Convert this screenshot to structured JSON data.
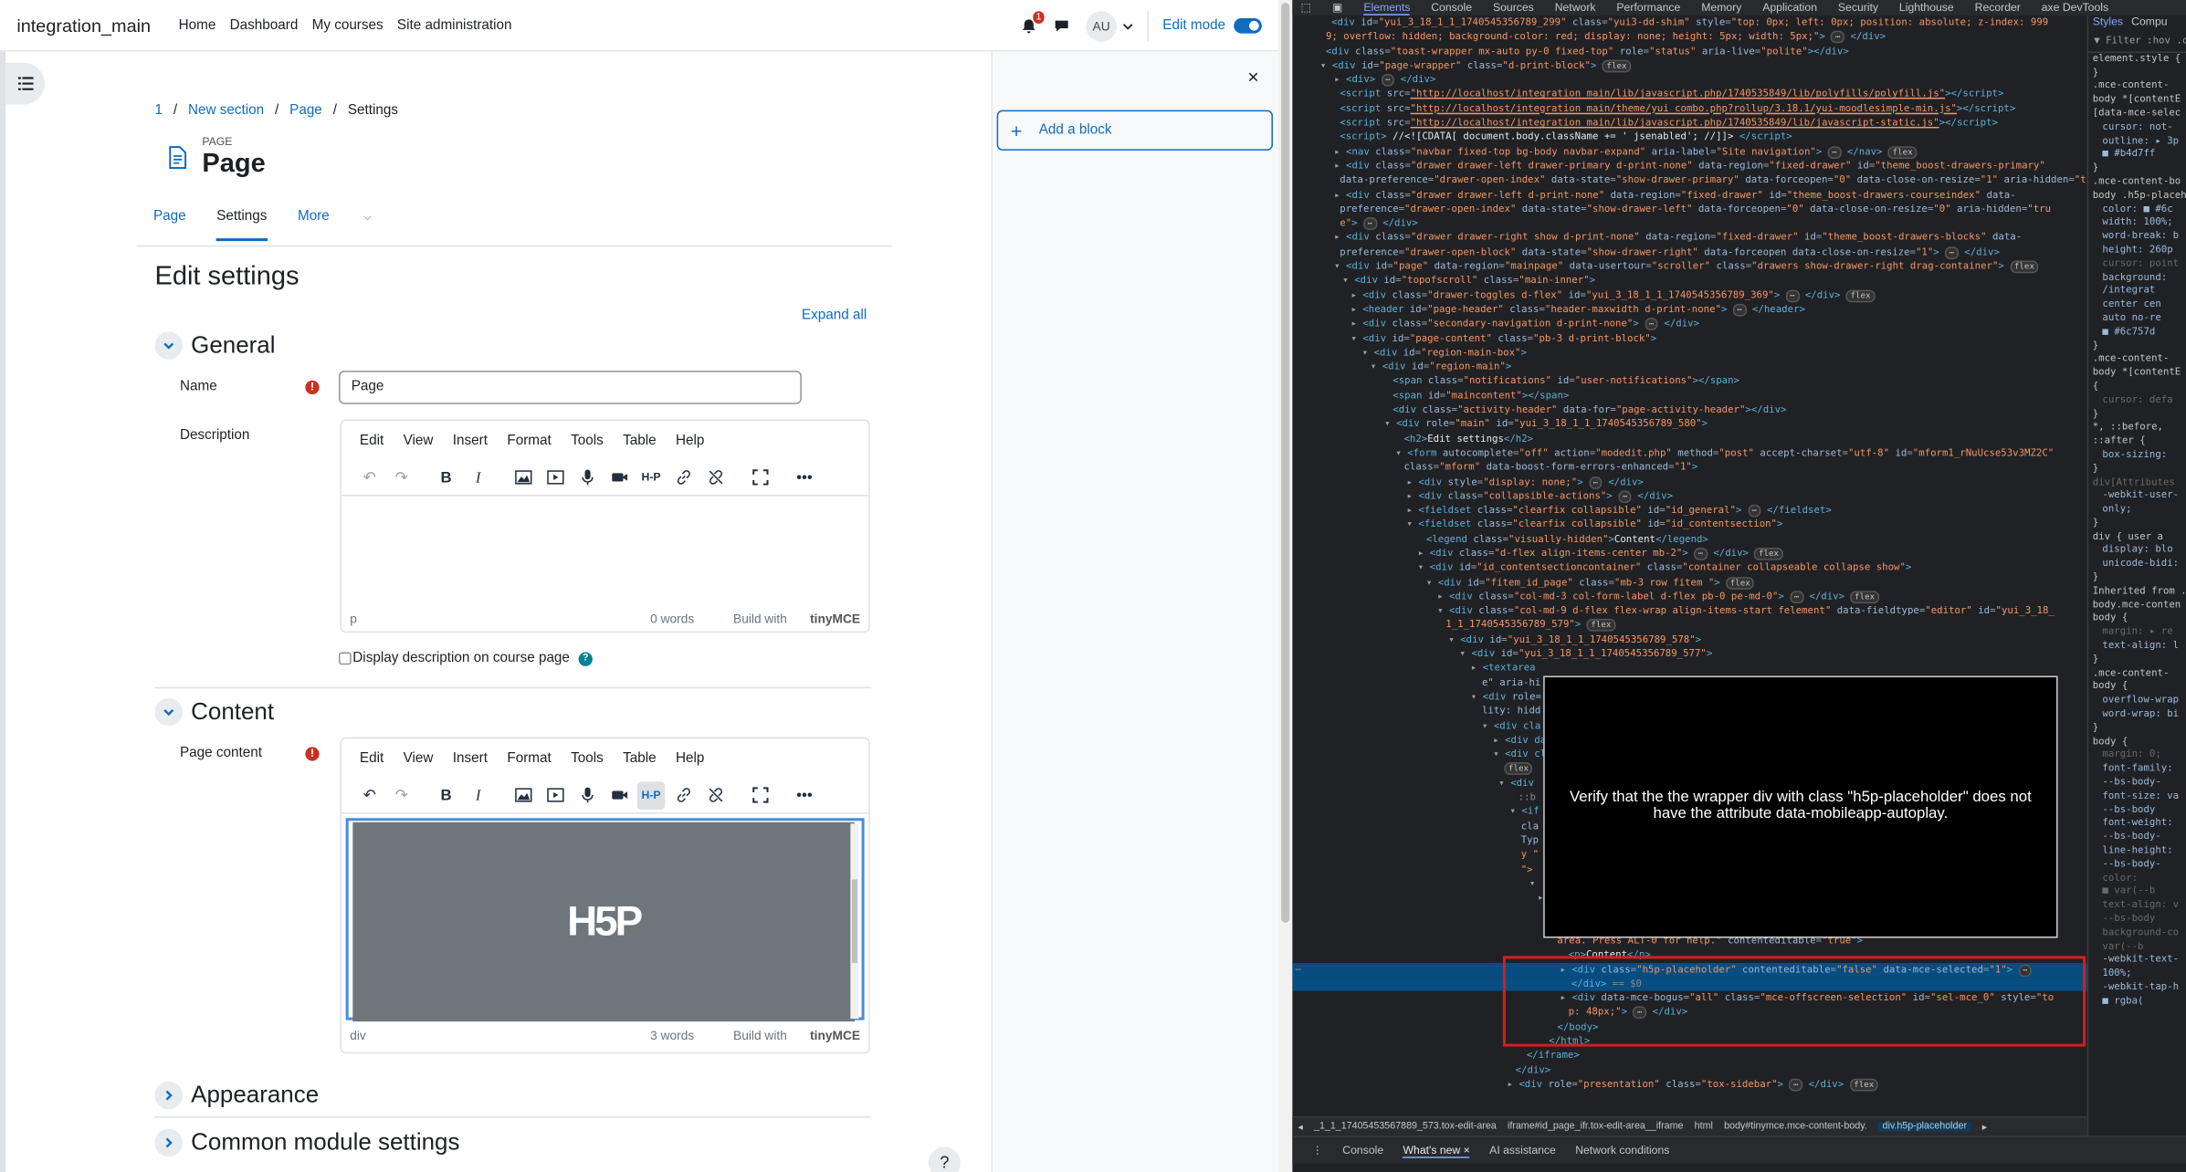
{
  "site": {
    "brand": "integration_main",
    "nav": [
      "Home",
      "Dashboard",
      "My courses",
      "Site administration"
    ]
  },
  "user": {
    "notifications_count": "1",
    "initials": "AU",
    "edit_mode_label": "Edit mode"
  },
  "drawer": {
    "close": "×",
    "add_block": "Add a block"
  },
  "breadcrumb": {
    "c1": "1",
    "sep": "/",
    "c2": "New section",
    "c3": "Page",
    "c4": "Settings"
  },
  "page": {
    "kind": "PAGE",
    "title": "Page"
  },
  "tabs": {
    "t1": "Page",
    "t2": "Settings",
    "t3": "More"
  },
  "form": {
    "heading": "Edit settings",
    "expand_all": "Expand all",
    "general": "General",
    "name_label": "Name",
    "name_value": "Page",
    "description_label": "Description",
    "display_desc": "Display description on course page",
    "content": "Content",
    "page_content_label": "Page content",
    "appearance": "Appearance",
    "common": "Common module settings"
  },
  "editor": {
    "menu": [
      "Edit",
      "View",
      "Insert",
      "Format",
      "Tools",
      "Table",
      "Help"
    ],
    "desc_status_path": "p",
    "desc_words": "0 words",
    "content_status_path": "div",
    "content_words": "3 words",
    "build_with": "Build with",
    "tinymce": "tinyMCE",
    "h5p_logo": "H5P",
    "h5p_button": "H-P"
  },
  "help_q": "?",
  "devtools": {
    "tabs": [
      "Elements",
      "Console",
      "Sources",
      "Network",
      "Performance",
      "Memory",
      "Application",
      "Security",
      "Lighthouse",
      "Recorder",
      "axe DevTools"
    ],
    "overlay_text": "Verify that the the wrapper div with class \"h5p-placeholder\" does not have the attribute data-mobileapp-autoplay.",
    "breadcrumb": [
      "_1_1_17405453567889_573.tox-edit-area",
      "iframe#id_page_ifr.tox-edit-area__iframe",
      "html",
      "body#tinymce.mce-content-body.",
      "div.h5p-placeholder"
    ],
    "drawer_tabs": [
      "Console",
      "What's new ×",
      "AI assistance",
      "Network conditions"
    ],
    "styles_tabs": [
      "Styles",
      "Compu"
    ]
  },
  "colors": {
    "accent": "#0f6cbf",
    "required": "#ca3120",
    "devtools_bg": "#202124",
    "highlight_box": "#d11f1f"
  }
}
